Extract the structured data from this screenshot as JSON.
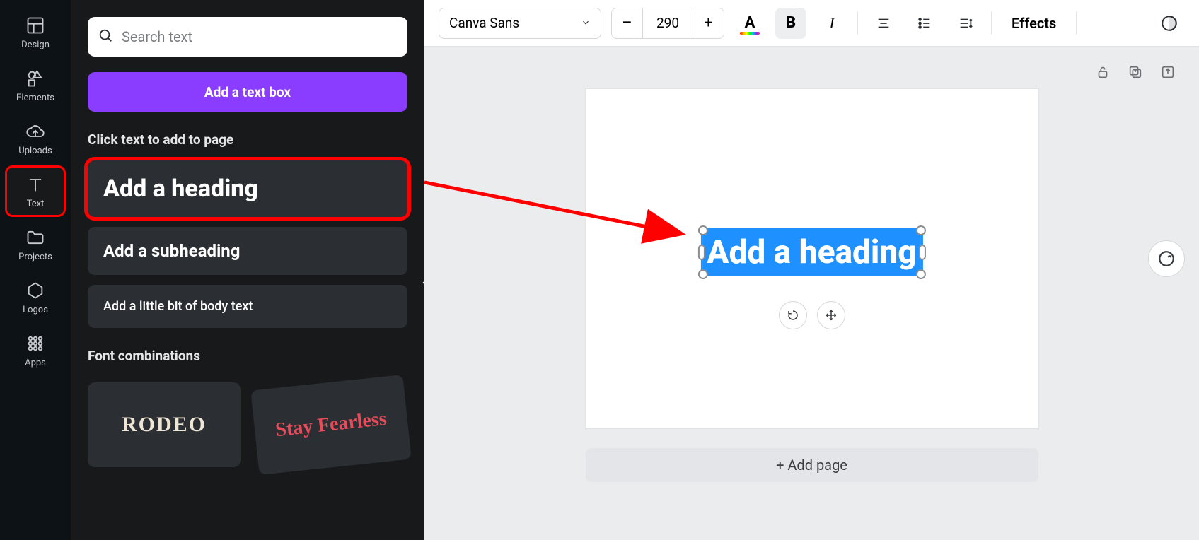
{
  "rail": {
    "items": [
      {
        "label": "Design"
      },
      {
        "label": "Elements"
      },
      {
        "label": "Uploads"
      },
      {
        "label": "Text"
      },
      {
        "label": "Projects"
      },
      {
        "label": "Logos"
      },
      {
        "label": "Apps"
      }
    ]
  },
  "panel": {
    "search_placeholder": "Search text",
    "add_text_box": "Add a text box",
    "section_label": "Click text to add to page",
    "heading": "Add a heading",
    "subheading": "Add a subheading",
    "body": "Add a little bit of body text",
    "font_combinations_label": "Font combinations",
    "combo1": "RODEO",
    "combo2": "Stay\nFearless"
  },
  "toolbar": {
    "font": "Canva Sans",
    "size": "290",
    "effects": "Effects"
  },
  "canvas": {
    "text_value": "Add a heading",
    "add_page": "+ Add page"
  }
}
